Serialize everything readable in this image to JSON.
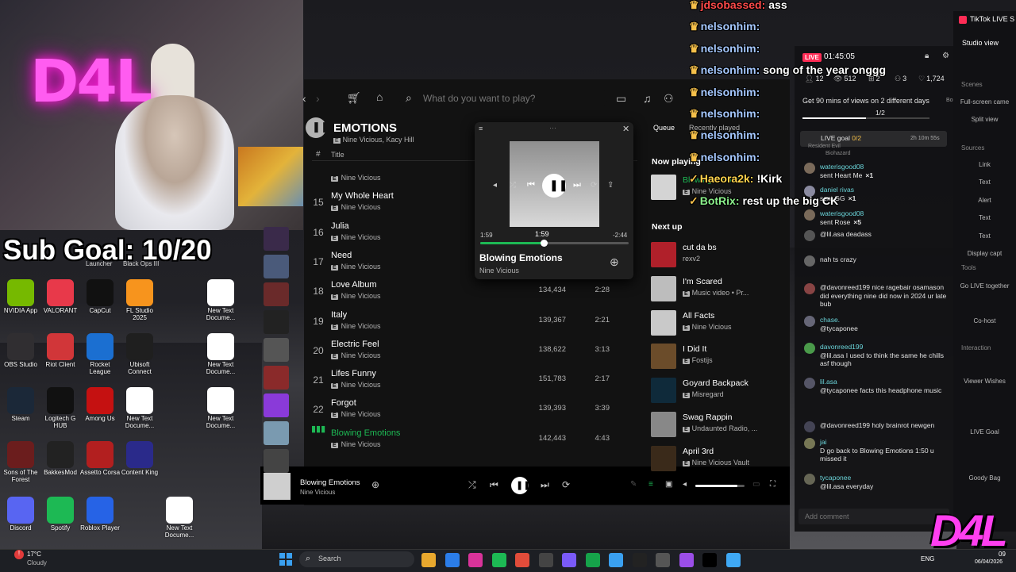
{
  "stream": {
    "sub_goal": "Sub Goal: 10/20",
    "neon_sign": "D4L",
    "watermark": "D4L"
  },
  "desktop_icons": [
    {
      "label": "NVIDIA App",
      "color": "#76b900"
    },
    {
      "label": "VALORANT",
      "color": "#e8394a"
    },
    {
      "label": "CapCut",
      "color": "#111111"
    },
    {
      "label": "FL Studio 2025",
      "color": "#f7941d"
    },
    {
      "label": "New Text Docume...",
      "color": "#ffffff"
    },
    {
      "label": "OBS Studio",
      "color": "#302e31"
    },
    {
      "label": "Riot Client",
      "color": "#d13639"
    },
    {
      "label": "Rocket League",
      "color": "#1b6fd1"
    },
    {
      "label": "Ubisoft Connect",
      "color": "#1f1f1f"
    },
    {
      "label": "New Text Docume...",
      "color": "#ffffff"
    },
    {
      "label": "Steam",
      "color": "#1b2838"
    },
    {
      "label": "Logitech G HUB",
      "color": "#111111"
    },
    {
      "label": "Among Us",
      "color": "#c51111"
    },
    {
      "label": "New Text Docume...",
      "color": "#ffffff"
    },
    {
      "label": "New Text Docume...",
      "color": "#ffffff"
    },
    {
      "label": "Sons of The Forest",
      "color": "#6b1d1d"
    },
    {
      "label": "BakkesMod",
      "color": "#222222"
    },
    {
      "label": "Assetto Corsa",
      "color": "#b21f1f"
    },
    {
      "label": "Content King",
      "color": "#2a2a8a"
    },
    {
      "label": "Discord",
      "color": "#5865f2"
    },
    {
      "label": "Spotify",
      "color": "#1db954"
    },
    {
      "label": "Roblox Player",
      "color": "#2663e6"
    },
    {
      "label": "New Text Docume...",
      "color": "#ffffff"
    }
  ],
  "desktop_partial_labels": {
    "launcher": "Launcher",
    "black_ops": "Black Ops III"
  },
  "spotify": {
    "search_placeholder": "What do you want to play?",
    "playlist_title": "EMOTIONS",
    "playlist_artists": "Nine Vicious, Kacy Hill",
    "col_hash": "#",
    "col_title": "Title",
    "explicit": "E",
    "tracks": [
      {
        "num": "",
        "title": "",
        "artist": "Nine Vicious",
        "plays": "",
        "duration": ""
      },
      {
        "num": "15",
        "title": "My Whole Heart",
        "artist": "Nine Vicious",
        "plays": "",
        "duration": ""
      },
      {
        "num": "16",
        "title": "Julia",
        "artist": "Nine Vicious",
        "plays": "",
        "duration": ""
      },
      {
        "num": "17",
        "title": "Need",
        "artist": "Nine Vicious",
        "plays": "",
        "duration": ""
      },
      {
        "num": "18",
        "title": "Love Album",
        "artist": "Nine Vicious",
        "plays": "134,434",
        "duration": "2:28"
      },
      {
        "num": "19",
        "title": "Italy",
        "artist": "Nine Vicious",
        "plays": "139,367",
        "duration": "2:21"
      },
      {
        "num": "20",
        "title": "Electric Feel",
        "artist": "Nine Vicious",
        "plays": "138,622",
        "duration": "3:13"
      },
      {
        "num": "21",
        "title": "Lifes Funny",
        "artist": "Nine Vicious",
        "plays": "151,783",
        "duration": "2:17"
      },
      {
        "num": "22",
        "title": "Forgot",
        "artist": "Nine Vicious",
        "plays": "139,393",
        "duration": "3:39"
      },
      {
        "num": "",
        "title": "Blowing Emotions",
        "artist": "Nine Vicious",
        "plays": "142,443",
        "duration": "4:43"
      }
    ],
    "queue_tab": "Queue",
    "recently_played_tab": "Recently played",
    "now_playing_heading": "Now playing",
    "now_playing": {
      "title": "Blowing Emotions",
      "artist": "Nine Vicious"
    },
    "next_up_heading": "Next up",
    "next_up": [
      {
        "title": "cut da bs",
        "artist": "rexv2",
        "explicit": false,
        "color": "#b0202a"
      },
      {
        "title": "I'm Scared",
        "artist": "Music video • Pr...",
        "explicit": true,
        "color": "#bdbdbd"
      },
      {
        "title": "All Facts",
        "artist": "Nine Vicious",
        "explicit": true,
        "color": "#c9c9c9"
      },
      {
        "title": "I Did It",
        "artist": "Fostijs",
        "explicit": true,
        "color": "#6b4c2a"
      },
      {
        "title": "Goyard Backpack",
        "artist": "Misregard",
        "explicit": true,
        "color": "#0f2a3a"
      },
      {
        "title": "Swag Rappin",
        "artist": "Undaunted Radio, ...",
        "explicit": true,
        "color": "#888888"
      },
      {
        "title": "April 3rd",
        "artist": "Nine Vicious Vault",
        "explicit": true,
        "color": "#3a2a1a"
      }
    ],
    "mini_player": {
      "time_elapsed": "1:59",
      "time_tooltip": "1:59",
      "time_remaining": "-2:44",
      "progress": 0.43,
      "title": "Blowing Emotions",
      "artist": "Nine Vicious"
    },
    "bar": {
      "title": "Blowing Emotions",
      "artist": "Nine Vicious",
      "volume": 0.85
    }
  },
  "chat_overlay": [
    {
      "user": "jdsobassed:",
      "msg": "ass",
      "user_color": "#ff4a4a"
    },
    {
      "user": "nelsonhim:",
      "msg": "",
      "user_color": "#a5c8ff"
    },
    {
      "user": "nelsonhim:",
      "msg": "",
      "user_color": "#a5c8ff"
    },
    {
      "user": "nelsonhim:",
      "msg": "song of the year onggg",
      "user_color": "#a5c8ff"
    },
    {
      "user": "nelsonhim:",
      "msg": "",
      "user_color": "#a5c8ff"
    },
    {
      "user": "nelsonhim:",
      "msg": "",
      "user_color": "#a5c8ff"
    },
    {
      "user": "nelsonhim:",
      "msg": "",
      "user_color": "#a5c8ff"
    },
    {
      "user": "nelsonhim:",
      "msg": "",
      "user_color": "#a5c8ff"
    },
    {
      "user": "Haeora2k:",
      "msg": "!Kirk",
      "user_color": "#ffd34d"
    },
    {
      "user": "BotRix:",
      "msg": "rest up the big CK",
      "user_color": "#8cf28c"
    }
  ],
  "tiktok": {
    "live_badge": "LIVE",
    "timer": "01:45:05",
    "stats": [
      "12",
      "512",
      "2",
      "3",
      "1,724"
    ],
    "promo": "Get 90 mins of views on 2 different days",
    "promo_tag": "Bonus",
    "promo_progress": "1/2",
    "promo_x": "×1",
    "live_goal": "LIVE goal",
    "live_goal_count": "0/2",
    "live_goal_time": "2h 10m 55s",
    "resident_evil": "Resident Evil",
    "biohazard": "Biohazard",
    "comment_placeholder": "Add comment",
    "feed": [
      {
        "user": "waterisgood08",
        "msg": "sent Heart Me",
        "suffix": "×1"
      },
      {
        "user": "daniel rivas",
        "msg": "sent GG",
        "suffix": "×1"
      },
      {
        "user": "waterisgood08",
        "msg": "sent Rose",
        "suffix": "×5"
      },
      {
        "user": "",
        "msg": "@lil.asa deadass",
        "suffix": ""
      },
      {
        "user": "",
        "msg": "nah ts crazy",
        "suffix": ""
      },
      {
        "user": "",
        "msg": "@davonreed199 nice ragebair osamason did everything nine did now in 2024 ur late bub",
        "suffix": ""
      },
      {
        "user": "chase.",
        "msg": "@tycaponee",
        "suffix": ""
      },
      {
        "user": "davonreed199",
        "msg": "@lil.asa I used to think the same he chills asf though",
        "suffix": ""
      },
      {
        "user": "lil.asa",
        "msg": "@tycaponee facts this headphone music",
        "suffix": ""
      },
      {
        "user": "",
        "msg": "@davonreed199 holy brainrot newgen",
        "suffix": ""
      },
      {
        "user": "jai",
        "msg": "D go back to Blowing Emotions 1:50 u missed it",
        "suffix": ""
      },
      {
        "user": "tycaponee",
        "msg": "@lil.asa everyday",
        "suffix": ""
      }
    ]
  },
  "studio": {
    "title": "TikTok LIVE S",
    "view": "Studio view",
    "items": [
      "Scenes",
      "Full-screen came",
      "Split view",
      "Sources",
      "Link",
      "Text",
      "Alert",
      "Text",
      "Text",
      "Display capt",
      "Tools",
      "Go LIVE together",
      "Co-host",
      "Interaction",
      "Viewer Wishes",
      "LIVE Goal",
      "Goody Bag"
    ]
  },
  "taskbar": {
    "weather_temp": "17°C",
    "weather_desc": "Cloudy",
    "search_placeholder": "Search",
    "lang": "ENG",
    "time": "09",
    "date": "06/04/2026"
  }
}
